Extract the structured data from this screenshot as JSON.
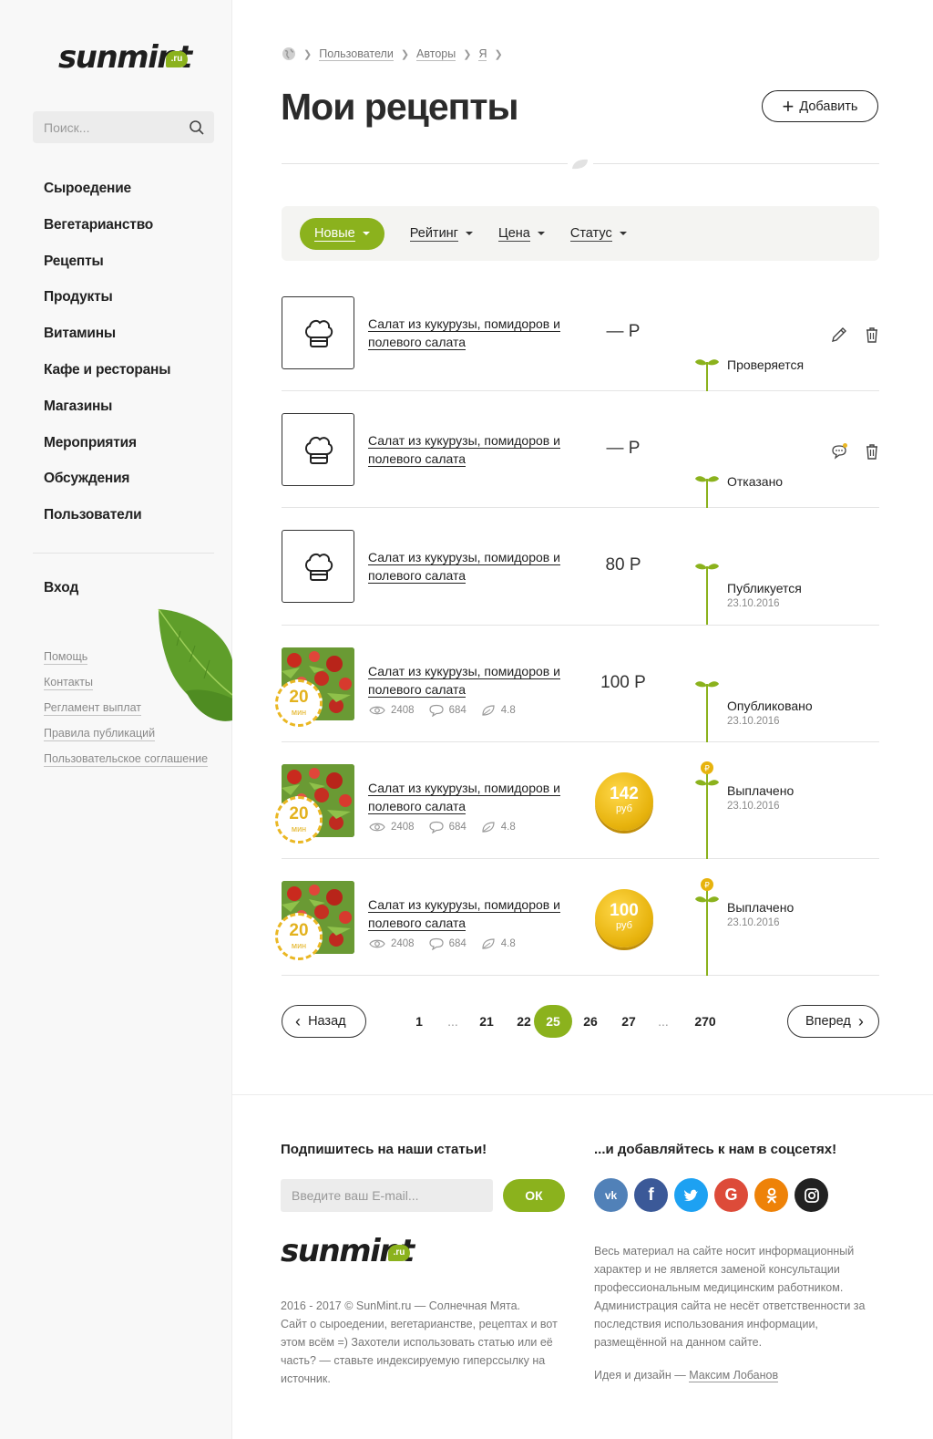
{
  "sidebar": {
    "logo_text": "sunmint",
    "logo_badge": ".ru",
    "search_placeholder": "Поиск...",
    "nav": [
      "Сыроедение",
      "Вегетарианство",
      "Рецепты",
      "Продукты",
      "Витамины",
      "Кафе и рестораны",
      "Магазины",
      "Мероприятия",
      "Обсуждения",
      "Пользователи"
    ],
    "login": "Вход",
    "links": [
      "Помощь",
      "Контакты",
      "Регламент выплат",
      "Правила публикаций",
      "Пользовательское соглашение"
    ]
  },
  "breadcrumb": [
    "Пользователи",
    "Авторы",
    "Я"
  ],
  "page_title": "Мои рецепты",
  "add_label": "Добавить",
  "filters": [
    "Новые",
    "Рейтинг",
    "Цена",
    "Статус"
  ],
  "recipes": [
    {
      "title": "Салат из кукурузы, помидоров и полевого салата",
      "price": "— Р",
      "status": "Проверяется",
      "date": "",
      "views": "",
      "comments": "",
      "rating": ""
    },
    {
      "title": "Салат из кукурузы, помидоров и полевого салата",
      "price": "— Р",
      "status": "Отказано",
      "date": "",
      "views": "",
      "comments": "",
      "rating": ""
    },
    {
      "title": "Салат из кукурузы, помидоров и полевого салата",
      "price": "80 Р",
      "status": "Публикуется",
      "date": "23.10.2016",
      "views": "",
      "comments": "",
      "rating": ""
    },
    {
      "title": "Салат из кукурузы, помидоров и полевого салата",
      "price": "100 Р",
      "status": "Опубликовано",
      "date": "23.10.2016",
      "views": "2408",
      "comments": "684",
      "rating": "4.8",
      "timer": "20",
      "timer_unit": "мин"
    },
    {
      "title": "Салат из кукурузы, помидоров и полевого салата",
      "coin": "142",
      "coin_unit": "руб",
      "status": "Выплачено",
      "date": "23.10.2016",
      "views": "2408",
      "comments": "684",
      "rating": "4.8",
      "timer": "20",
      "timer_unit": "мин"
    },
    {
      "title": "Салат из кукурузы, помидоров и полевого салата",
      "coin": "100",
      "coin_unit": "руб",
      "status": "Выплачено",
      "date": "23.10.2016",
      "views": "2408",
      "comments": "684",
      "rating": "4.8",
      "timer": "20",
      "timer_unit": "мин"
    }
  ],
  "pagination": {
    "prev": "Назад",
    "next": "Вперед",
    "pages": [
      "1",
      "...",
      "21",
      "22",
      "25",
      "26",
      "27",
      "...",
      "270"
    ],
    "current": "25"
  },
  "footer": {
    "subscribe_heading": "Подпишитесь на наши статьи!",
    "email_placeholder": "Введите ваш E-mail...",
    "ok_label": "ОК",
    "social_heading": "...и добавляйтесь к нам в соцсетях!",
    "socials": [
      {
        "name": "vk-icon",
        "glyph": "vk",
        "color": "#5181b8"
      },
      {
        "name": "facebook-icon",
        "glyph": "f",
        "color": "#3b5998"
      },
      {
        "name": "twitter-icon",
        "glyph": "t",
        "color": "#1da1f2"
      },
      {
        "name": "google-icon",
        "glyph": "G",
        "color": "#dd4b39"
      },
      {
        "name": "odnoklassniki-icon",
        "glyph": "ok",
        "color": "#ee8208"
      },
      {
        "name": "instagram-icon",
        "glyph": "ig",
        "color": "#222222"
      }
    ],
    "copyright": "2016 - 2017 © SunMint.ru — Солнечная Мята.\nСайт о сыроедении, вегетарианстве, рецептах и вот этом всём =) Захотели использовать статью или её часть? — ставьте индексируемую гиперссылку на источник.",
    "disclaimer": "Весь материал на сайте носит информационный характер и не является заменой консультации профессиональным медицинским работником. Администрация сайта не несёт ответственности за последствия использования информации, размещённой на данном сайте.",
    "credit_prefix": "Идея и дизайн —",
    "credit_author": "Максим Лобанов"
  },
  "colors": {
    "accent": "#8bb21d",
    "coin": "#e7b30d",
    "timer": "#eab723"
  }
}
